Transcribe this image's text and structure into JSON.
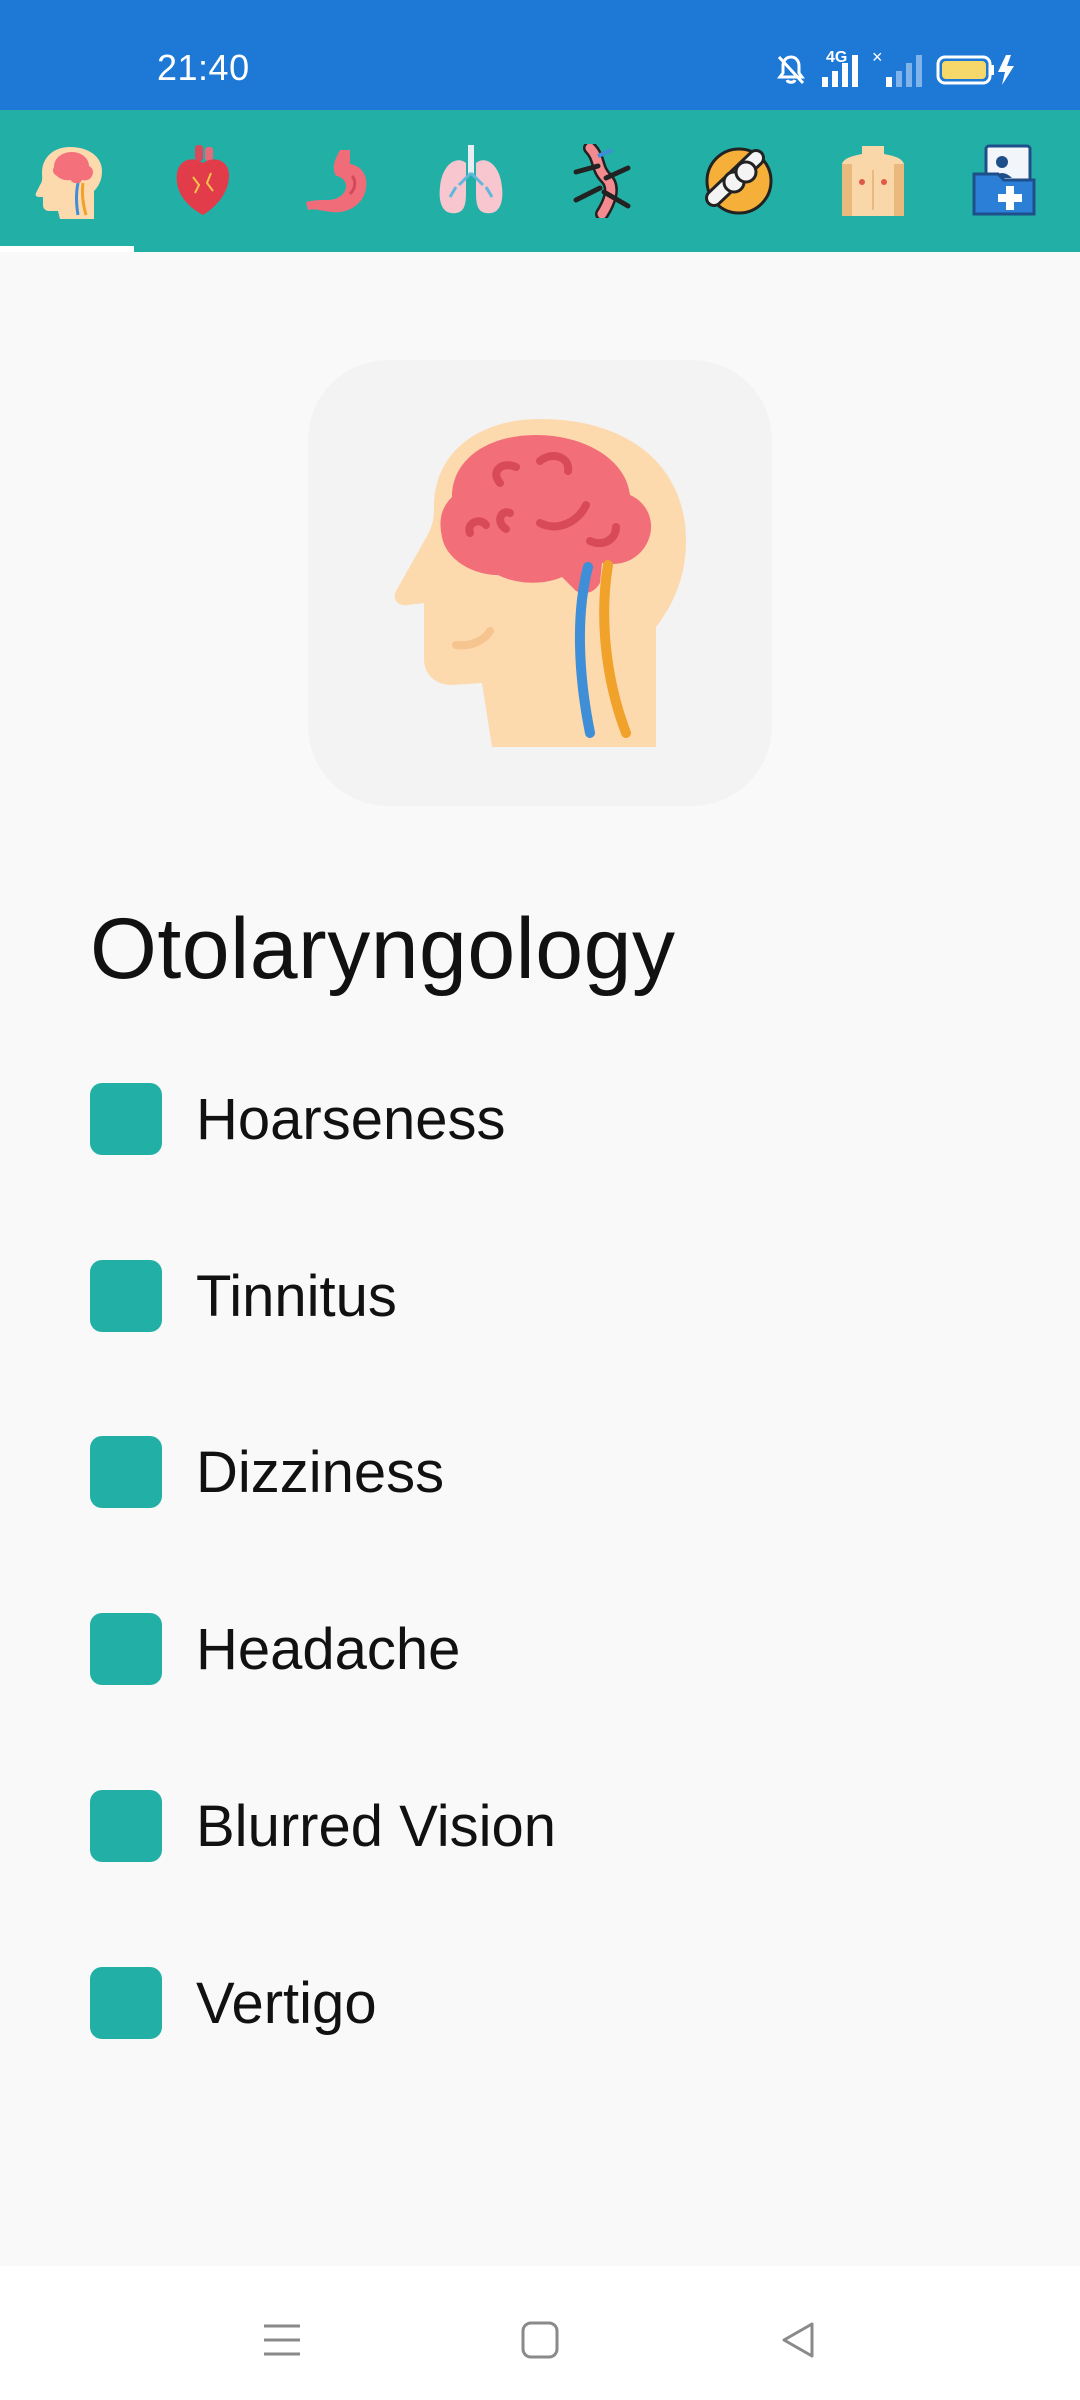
{
  "status": {
    "time": "21:40",
    "network": "4G"
  },
  "tabs": [
    {
      "name": "head-brain-icon",
      "selected": true
    },
    {
      "name": "heart-icon"
    },
    {
      "name": "stomach-icon"
    },
    {
      "name": "lungs-icon"
    },
    {
      "name": "blood-vessel-icon"
    },
    {
      "name": "joint-icon"
    },
    {
      "name": "torso-icon"
    },
    {
      "name": "medical-folder-icon"
    }
  ],
  "page": {
    "title": "Otolaryngology",
    "hero_icon": "head-brain-icon"
  },
  "symptoms": [
    {
      "label": "Hoarseness"
    },
    {
      "label": "Tinnitus"
    },
    {
      "label": "Dizziness"
    },
    {
      "label": "Headache"
    },
    {
      "label": "Blurred Vision"
    },
    {
      "label": "Vertigo"
    }
  ],
  "colors": {
    "status_bar": "#1e78d6",
    "accent": "#22b0a6",
    "background": "#f9f9f9"
  }
}
